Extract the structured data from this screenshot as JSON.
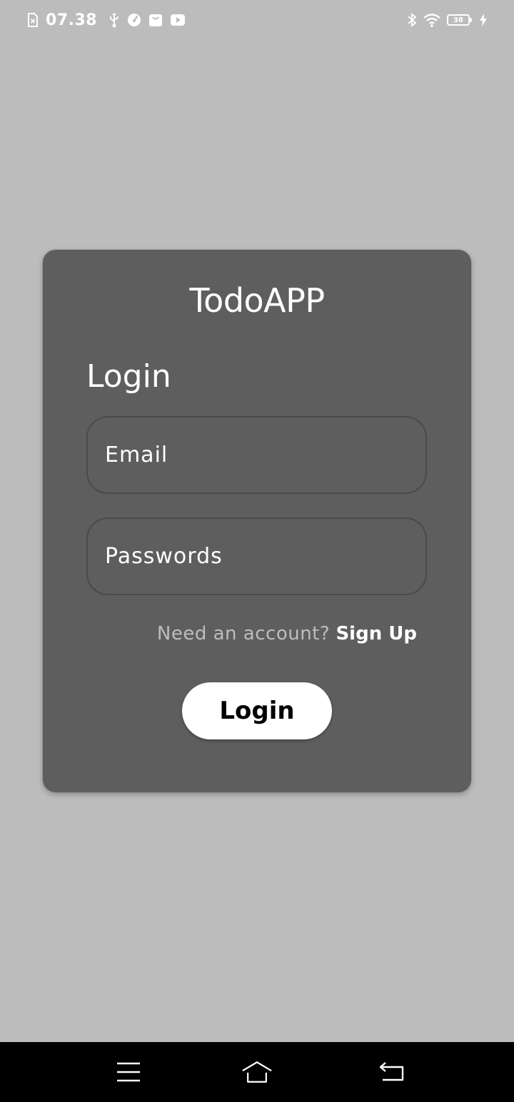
{
  "status_bar": {
    "time": "07.38",
    "battery_level": "38",
    "icons_left": [
      "screenshot-icon",
      "usb-icon",
      "speedometer-icon",
      "shopping-bag-icon",
      "youtube-icon"
    ],
    "icons_right": [
      "bluetooth-icon",
      "wifi-icon",
      "battery-icon",
      "charging-icon"
    ]
  },
  "card": {
    "app_title": "TodoAPP",
    "heading": "Login",
    "email_placeholder": "Email",
    "password_placeholder": "Passwords",
    "signup_prompt": "Need an account?",
    "signup_link": "Sign Up",
    "login_button": "Login"
  },
  "nav_bar": {
    "icons": [
      "menu-icon",
      "home-icon",
      "back-icon"
    ]
  },
  "colors": {
    "background": "#bcbcbc",
    "card": "#5e5e5e",
    "button": "#ffffff",
    "nav_bar": "#000000"
  }
}
